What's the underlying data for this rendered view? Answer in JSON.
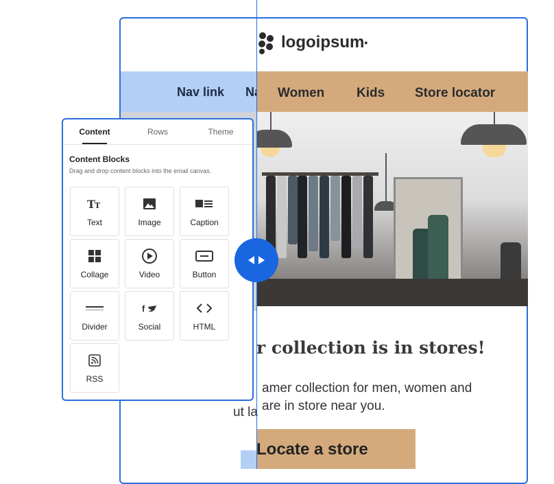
{
  "comparison": {
    "left": {
      "nav_links": [
        "Nav link",
        "Na"
      ],
      "body_fragment": "ut la"
    },
    "right": {
      "logo_text": "logoipsum",
      "nav_links": [
        "Women",
        "Kids",
        "Store locator"
      ],
      "headline": "r collection is in stores!",
      "body_lines": [
        "amer collection for men, women and",
        "are in store near you."
      ],
      "cta_label": "Locate a store"
    },
    "colors": {
      "left_nav_bg": "#b3cff5",
      "right_nav_bg": "#d4aa7d",
      "accent_blue": "#1a66e0"
    },
    "handle_icon": "compare-arrows-icon"
  },
  "panel": {
    "tabs": [
      {
        "label": "Content",
        "active": true
      },
      {
        "label": "Rows",
        "active": false
      },
      {
        "label": "Theme",
        "active": false
      }
    ],
    "section_title": "Content Blocks",
    "section_desc": "Drag and drop content blocks into the email canvas.",
    "blocks": [
      {
        "label": "Text",
        "icon": "text-icon"
      },
      {
        "label": "Image",
        "icon": "image-icon"
      },
      {
        "label": "Caption",
        "icon": "caption-icon"
      },
      {
        "label": "Collage",
        "icon": "collage-icon"
      },
      {
        "label": "Video",
        "icon": "video-icon"
      },
      {
        "label": "Button",
        "icon": "button-icon"
      },
      {
        "label": "Divider",
        "icon": "divider-icon"
      },
      {
        "label": "Social",
        "icon": "social-icon"
      },
      {
        "label": "HTML",
        "icon": "html-icon"
      },
      {
        "label": "RSS",
        "icon": "rss-icon"
      }
    ]
  }
}
